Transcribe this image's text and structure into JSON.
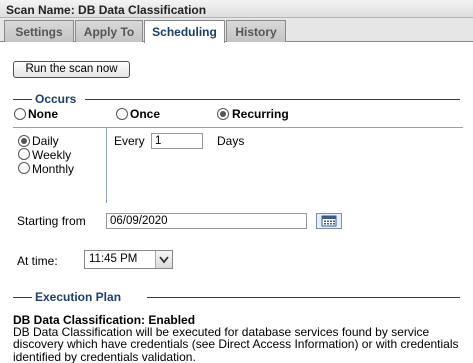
{
  "title": "Scan Name: DB Data Classification",
  "tabs": [
    {
      "label": "Settings"
    },
    {
      "label": "Apply To"
    },
    {
      "label": "Scheduling"
    },
    {
      "label": "History"
    }
  ],
  "active_tab": "Scheduling",
  "run_button": "Run the scan now",
  "occurs": {
    "heading": "Occurs",
    "options": [
      "None",
      "Once",
      "Recurring"
    ],
    "selected": "Recurring"
  },
  "frequency": {
    "options": [
      "Daily",
      "Weekly",
      "Monthly"
    ],
    "selected": "Daily",
    "every_label": "Every",
    "every_value": "1",
    "unit_label": "Days"
  },
  "starting_from": {
    "label": "Starting from",
    "value": "06/09/2020"
  },
  "at_time": {
    "label": "At time:",
    "value": "11:45 PM"
  },
  "execution_plan": {
    "heading": "Execution Plan",
    "status": "DB Data Classification: Enabled",
    "description": "DB Data Classification will be executed for database services found by service discovery which have credentials (see Direct Access Information) or with credentials identified by credentials validation."
  },
  "colors": {
    "section_heading": "#1f3f70",
    "active_tab_text": "#1a3e6e"
  }
}
